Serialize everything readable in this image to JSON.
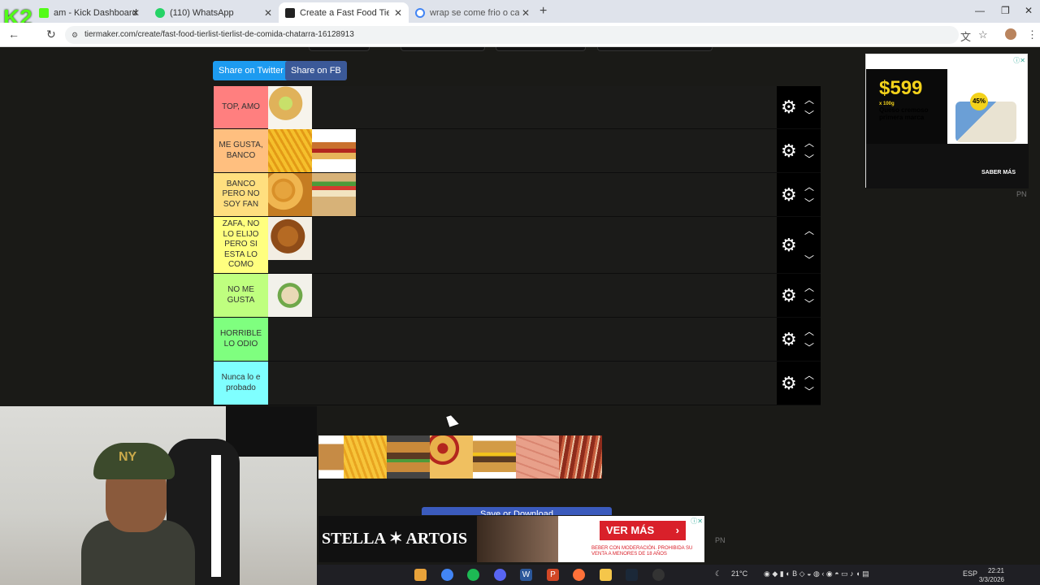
{
  "browser": {
    "tabs": [
      {
        "label": "am - Kick Dashboard",
        "active": false
      },
      {
        "label": "(110) WhatsApp",
        "active": false
      },
      {
        "label": "Create a Fast Food Tierlist/Tierli",
        "active": true
      },
      {
        "label": "wrap se come frio o caliente - B",
        "active": false
      }
    ],
    "url": "tiermaker.com/create/fast-food-tierlist-tierlist-de-comida-chatarra-16128913",
    "stream_logo": "K2"
  },
  "share": {
    "twitter": "Share on Twitter",
    "facebook": "Share on FB"
  },
  "tiers": [
    {
      "label": "TOP, AMO",
      "color": "#ff7f7f",
      "items": [
        "tacos"
      ]
    },
    {
      "label": "ME GUSTA, BANCO",
      "color": "#ffbf7f",
      "items": [
        "fries",
        "hotdog"
      ]
    },
    {
      "label": "BANCO PERO NO SOY FAN",
      "color": "#ffdf7f",
      "items": [
        "nuggets",
        "sandwich"
      ]
    },
    {
      "label": "ZAFA, NO LO ELIJO PERO SI ESTA LO COMO",
      "color": "#ffff7f",
      "items": [
        "fried-chicken"
      ]
    },
    {
      "label": "NO ME GUSTA",
      "color": "#bfff7f",
      "items": [
        "wrap"
      ]
    },
    {
      "label": "HORRIBLE LO ODIO",
      "color": "#7fff7f",
      "items": []
    },
    {
      "label": "Nunca lo e probado",
      "color": "#7fffff",
      "items": []
    }
  ],
  "pool_items": [
    "pancakes",
    "fries-cheese",
    "burger",
    "pizza",
    "cheeseburger",
    "sausages",
    "bacon"
  ],
  "save_button": "Save or Download",
  "ad_top": {
    "price": "$599",
    "unit": "x 100g",
    "desc": "Queso cremoso primera marca",
    "badge": "45%",
    "cta": "SABER MÁS",
    "pn": "PN"
  },
  "ad_bottom": {
    "brand": "STELLA ✶ ARTOIS",
    "cta": "VER MÁS",
    "legal": "BEBER CON MODERACIÓN. PROHIBIDA SU VENTA A MENORES DE 18 AÑOS",
    "pn": "PN"
  },
  "taskbar": {
    "weather": "21°C",
    "lang": "ESP",
    "time": "22:21",
    "date": "3/3/2026"
  }
}
